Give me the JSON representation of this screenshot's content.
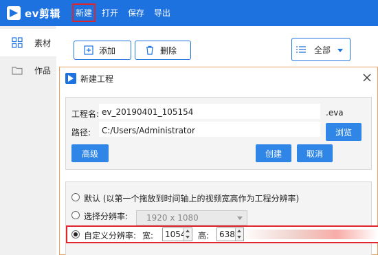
{
  "app": {
    "name": "ev剪辑",
    "brand_color": "#1d72e0",
    "highlight_color": "#e0262c"
  },
  "menu": [
    {
      "label": "新建",
      "active": true
    },
    {
      "label": "打开"
    },
    {
      "label": "保存"
    },
    {
      "label": "导出"
    }
  ],
  "sidebar": {
    "items": [
      {
        "label": "素材",
        "icon": "grid-icon",
        "active": true
      },
      {
        "label": "作品",
        "icon": "folder-icon"
      }
    ]
  },
  "toolbar": {
    "add_label": "添加",
    "delete_label": "删除",
    "filter_label": "全部"
  },
  "dialog": {
    "title": "新建工程",
    "project_name_label": "工程名:",
    "project_name_value": "ev_20190401_105154",
    "extension": ".eva",
    "path_label": "路径:",
    "path_value": "C:/Users/Administrator",
    "browse_label": "浏览",
    "advanced_label": "高级",
    "create_label": "创建",
    "cancel_label": "取消",
    "resolution": {
      "default_label": "默认 (以第一个拖放到时间轴上的视频宽高作为工程分辨率)",
      "preset_label": "选择分辨率:",
      "preset_value": "1920 x 1080",
      "custom_label": "自定义分辨率:",
      "width_label": "宽:",
      "width_value": "1054",
      "height_label": "高:",
      "height_value": "638",
      "selected": "custom"
    }
  }
}
